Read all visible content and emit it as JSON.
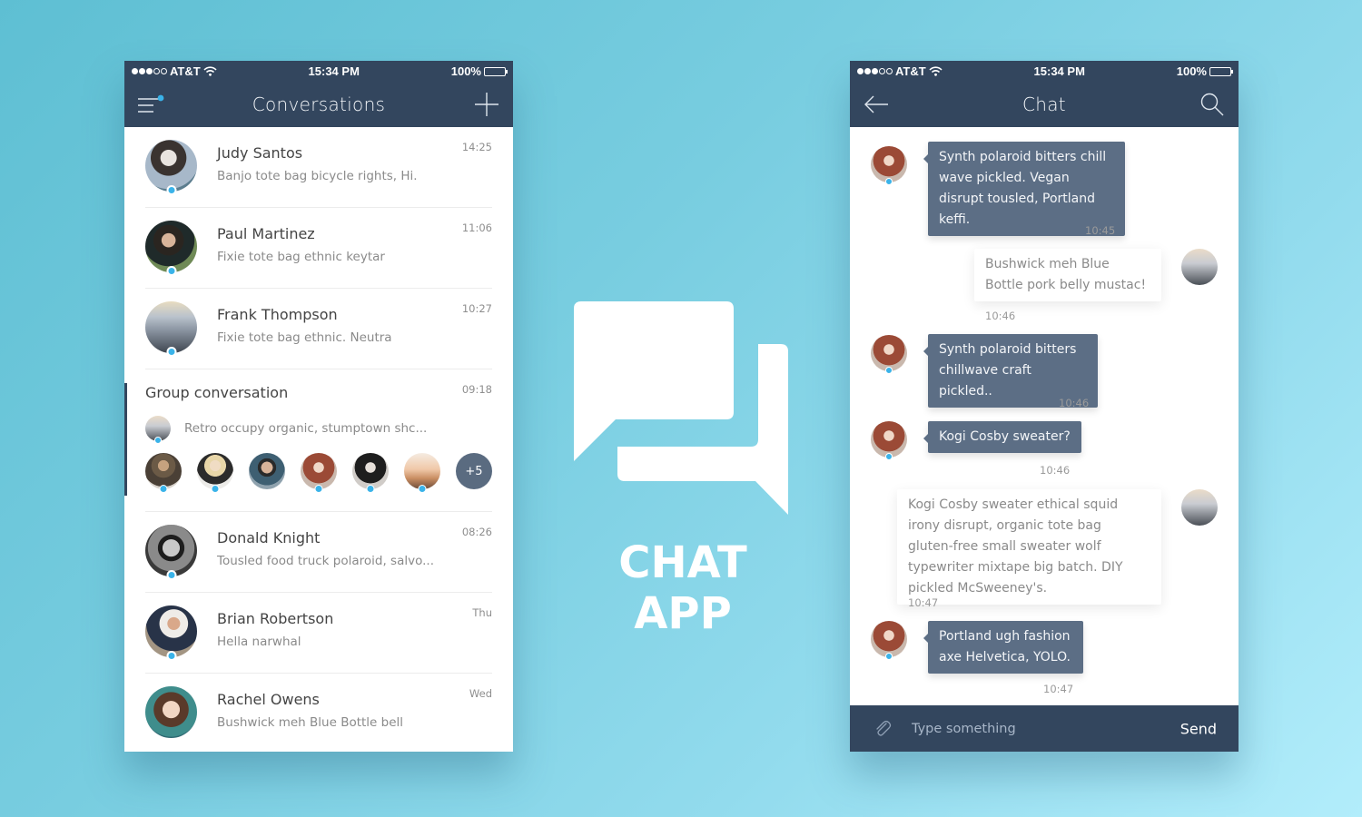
{
  "colors": {
    "header": "#33465e",
    "bubble_incoming": "#5c6e85",
    "online_dot": "#3ab3e9"
  },
  "status_bar": {
    "carrier": "AT&T",
    "signal_bars": 3,
    "signal_max": 5,
    "time": "15:34 PM",
    "battery": "100%"
  },
  "conversations_screen": {
    "title": "Conversations",
    "menu_icon": "hamburger-menu-icon",
    "add_icon": "plus-icon",
    "items": [
      {
        "name": "Judy Santos",
        "preview": "Banjo tote bag bicycle rights, Hi.",
        "time": "14:25",
        "online": true
      },
      {
        "name": "Paul Martinez",
        "preview": "Fixie tote bag ethnic keytar",
        "time": "11:06",
        "online": true
      },
      {
        "name": "Frank Thompson",
        "preview": "Fixie tote bag ethnic. Neutra",
        "time": "10:27",
        "online": true
      }
    ],
    "group": {
      "title": "Group conversation",
      "time": "09:18",
      "last_message": "Retro occupy organic, stumptown shc...",
      "member_count_visible": 6,
      "more_label": "+5"
    },
    "items_after_group": [
      {
        "name": "Donald Knight",
        "preview": "Tousled food truck polaroid, salvo...",
        "time": "08:26",
        "online": true
      },
      {
        "name": "Brian Robertson",
        "preview": "Hella narwhal",
        "time": "Thu",
        "online": true
      },
      {
        "name": "Rachel Owens",
        "preview": "Bushwick meh Blue Bottle bell",
        "time": "Wed",
        "online": false
      }
    ]
  },
  "brand": {
    "title": "CHAT APP",
    "icon": "chat-bubbles-icon"
  },
  "chat_screen": {
    "title": "Chat",
    "back_icon": "arrow-left-icon",
    "search_icon": "search-icon",
    "messages": [
      {
        "direction": "in",
        "text": "Synth polaroid bitters chill wave pickled. Vegan disrupt tousled, Portland keffi.",
        "time": "10:45"
      },
      {
        "direction": "out",
        "text": "Bushwick meh Blue Bottle pork belly mustac!",
        "time": "10:46"
      },
      {
        "direction": "in",
        "text": "Synth polaroid bitters chillwave craft pickled..",
        "time": "10:46"
      },
      {
        "direction": "in",
        "text": "Kogi Cosby sweater?",
        "time": "10:46"
      },
      {
        "direction": "out",
        "text": "Kogi Cosby sweater ethical squid irony disrupt, organic tote bag gluten-free small sweater wolf typewriter mixtape big batch. DIY pickled McSweeney's.",
        "time": "10:47"
      },
      {
        "direction": "in",
        "text": "Portland ugh fashion axe Helvetica, YOLO.",
        "time": "10:47"
      }
    ],
    "composer": {
      "placeholder": "Type something",
      "value": "",
      "send_label": "Send",
      "attach_icon": "paperclip-icon"
    }
  }
}
